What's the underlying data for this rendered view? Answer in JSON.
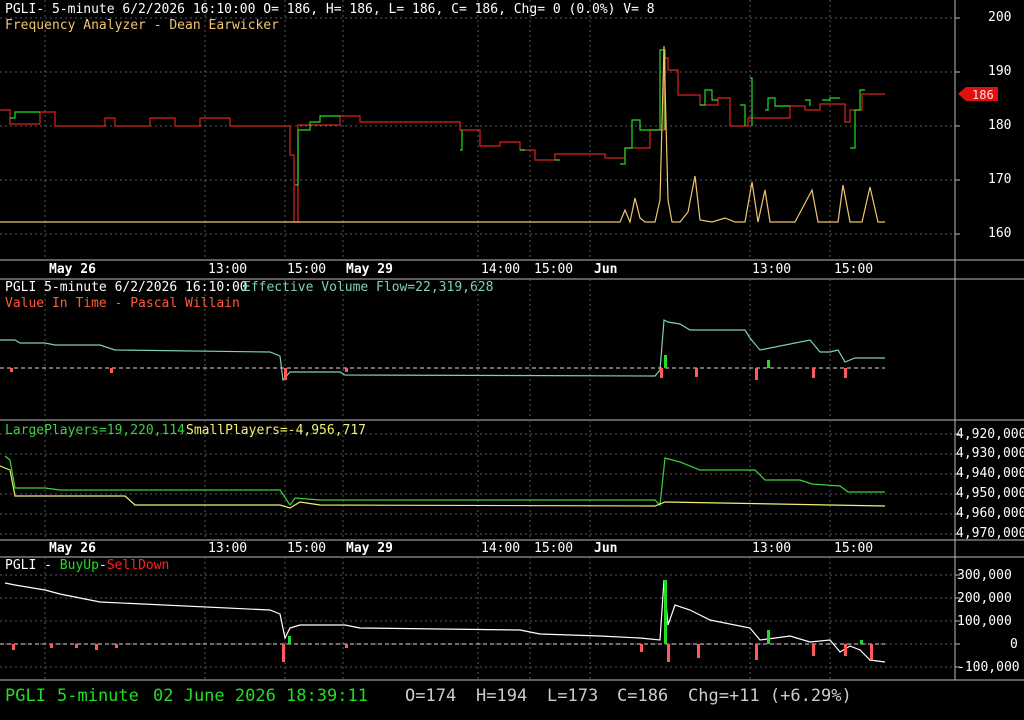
{
  "colors": {
    "background": "#000000",
    "grid": "#5a5a5a",
    "axis": "#cfcfcf",
    "price_up": "#22dd22",
    "price_down": "#dd2222",
    "freq": "#f0c470",
    "flow": "#7fd0b6",
    "large": "#3ed03e",
    "small": "#f0f070",
    "buyup": "#22dd22",
    "selldown": "#ff2222",
    "current_price_bg": "#e01010"
  },
  "panel1": {
    "header": "PGLI- 5-minute 6/2/2026 16:10:00 O= 186, H= 186, L= 186, C= 186, Chg= 0 (0.0%) V= 8",
    "indicator": "Frequency Analyzer - Dean Earwicker",
    "y_ticks": [
      "200",
      "190",
      "180",
      "170",
      "160"
    ],
    "current_price": "186"
  },
  "time_axis": {
    "days": [
      "May 26",
      "May 29",
      "Jun"
    ],
    "times": [
      "13:00",
      "15:00",
      "14:00",
      "15:00",
      "13:00",
      "15:00"
    ]
  },
  "panel2": {
    "symbol_line": "PGLI 5-minute  6/2/2026 16:10:00",
    "flow_label": "Effective Volume Flow=22,319,628",
    "indicator": "Value In Time - Pascal Willain"
  },
  "panel3": {
    "large_label": "LargePlayers=19,220,114",
    "small_label": "SmallPlayers=-4,956,717",
    "y_ticks": [
      "4,920,000",
      "4,930,000",
      "4,940,000",
      "4,950,000",
      "4,960,000",
      "4,970,000"
    ]
  },
  "panel4": {
    "prefix": "PGLI - ",
    "buyup": "BuyUp",
    "dash": "-",
    "selldown": "SellDown",
    "y_ticks": [
      "300,000",
      "200,000",
      "100,000",
      "0",
      "-100,000"
    ]
  },
  "status_bar": {
    "symbol": "PGLI",
    "interval": "5-minute",
    "datetime": "02 June 2026 18:39:11",
    "open": "O=174",
    "high": "H=194",
    "low": "L=173",
    "close": "C=186",
    "change": "Chg=+11 (+6.29%)"
  }
}
